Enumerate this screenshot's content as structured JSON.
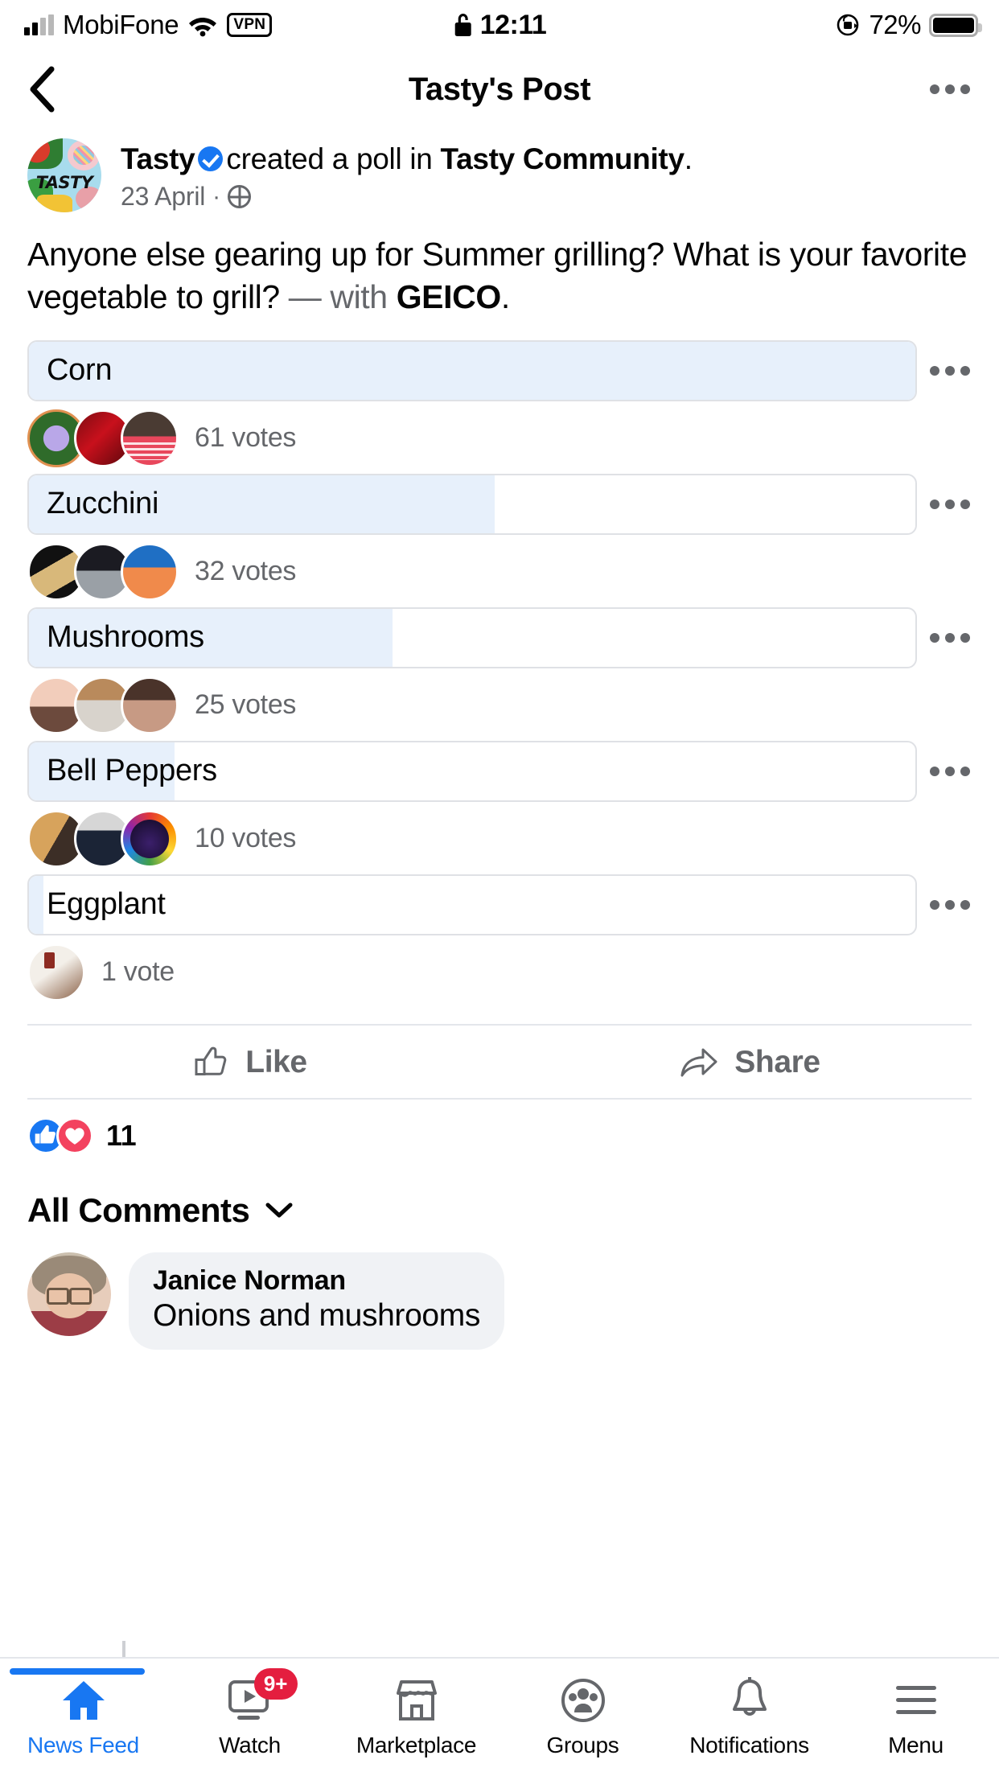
{
  "status_bar": {
    "carrier": "MobiFone",
    "vpn_label": "VPN",
    "time": "12:11",
    "battery_percent": "72%",
    "icons": [
      "signal-bars-icon",
      "wifi-icon",
      "vpn-badge-icon",
      "lock-icon",
      "rotation-lock-icon",
      "battery-icon"
    ]
  },
  "nav": {
    "title": "Tasty's Post",
    "back_icon": "back-chevron-icon",
    "more_icon": "more-options-icon"
  },
  "post": {
    "author": "Tasty",
    "verified": true,
    "action_text_1": "created a poll in",
    "group": "Tasty Community",
    "trailing_period": ".",
    "date": "23 April",
    "separator": "·",
    "privacy_icon": "globe-icon",
    "body_start": "Anyone else gearing up for Summer grilling? What is your favorite vegetable to grill?",
    "body_dim": "— with",
    "body_sponsor": "GEICO",
    "body_end": "."
  },
  "poll": {
    "options": [
      {
        "label": "Corn",
        "votes_text": "61 votes",
        "votes": 61,
        "percent": 100.0,
        "faces": [
          "f-flower",
          "f-red",
          "f-staying"
        ]
      },
      {
        "label": "Zucchini",
        "votes_text": "32 votes",
        "votes": 32,
        "percent": 52.5,
        "faces": [
          "f-hat",
          "f-car",
          "f-orange"
        ]
      },
      {
        "label": "Mushrooms",
        "votes_text": "25 votes",
        "votes": 25,
        "percent": 41.0,
        "faces": [
          "f-pink",
          "f-dog",
          "f-brown"
        ]
      },
      {
        "label": "Bell Peppers",
        "votes_text": "10 votes",
        "votes": 10,
        "percent": 16.4,
        "faces": [
          "f-golden",
          "f-suit",
          "f-rainbow"
        ]
      },
      {
        "label": "Eggplant",
        "votes_text": "1 vote",
        "votes": 1,
        "percent": 1.6,
        "faces": [
          "f-logo"
        ]
      }
    ],
    "option_more_icon": "poll-option-more-icon"
  },
  "actions": {
    "like_label": "Like",
    "like_icon": "thumbs-up-outline-icon",
    "share_label": "Share",
    "share_icon": "share-arrow-icon"
  },
  "reactions": {
    "count": "11",
    "types": [
      "like-reaction-icon",
      "love-reaction-icon"
    ]
  },
  "comments": {
    "header": "All Comments",
    "header_chevron": "chevron-down-icon",
    "items": [
      {
        "name": "Janice Norman",
        "text": "Onions and mushrooms"
      }
    ]
  },
  "tabbar": {
    "items": [
      {
        "label": "News Feed",
        "icon": "home-icon",
        "active": true,
        "badge": ""
      },
      {
        "label": "Watch",
        "icon": "watch-video-icon",
        "active": false,
        "badge": "9+"
      },
      {
        "label": "Marketplace",
        "icon": "marketplace-icon",
        "active": false,
        "badge": ""
      },
      {
        "label": "Groups",
        "icon": "groups-icon",
        "active": false,
        "badge": ""
      },
      {
        "label": "Notifications",
        "icon": "bell-icon",
        "active": false,
        "badge": ""
      },
      {
        "label": "Menu",
        "icon": "hamburger-menu-icon",
        "active": false,
        "badge": ""
      }
    ]
  },
  "colors": {
    "brand_blue": "#1877f2",
    "poll_fill": "#e7f0fb",
    "text_primary": "#050505",
    "text_secondary": "#65676b",
    "badge_red": "#e41e3f",
    "bubble_bg": "#f0f2f5"
  }
}
